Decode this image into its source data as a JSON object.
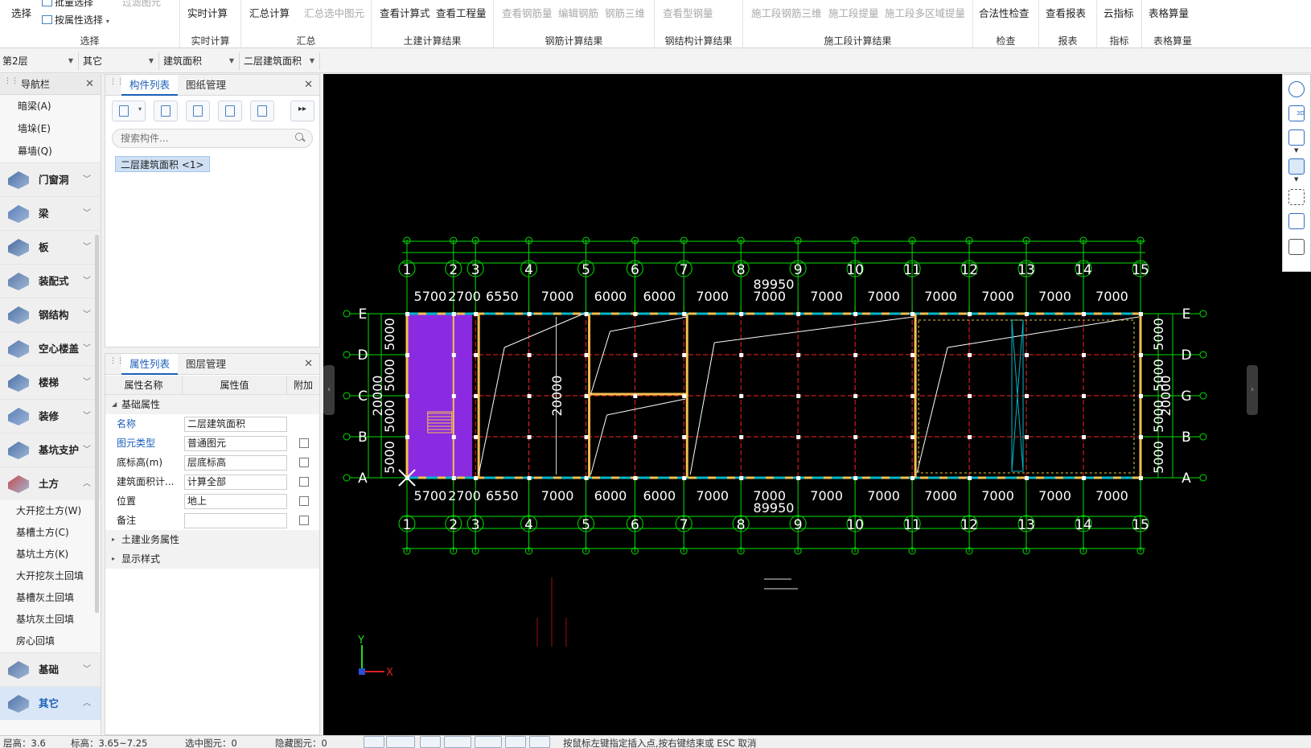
{
  "ribbon": {
    "select_group": {
      "select": "选择",
      "batch_select": "批量选择",
      "filter": "过滤图元",
      "by_attr": "按属性选择",
      "label": "选择"
    },
    "realtime_group": {
      "realtime": "实时计算",
      "label": "实时计算"
    },
    "summary_group": {
      "summary": "汇总计算",
      "summary_selected": "汇总选中图元",
      "label": "汇总"
    },
    "civil_group": {
      "formula": "查看计算式",
      "quantity": "查看工程量",
      "label": "土建计算结果"
    },
    "rebar_group": {
      "view_rebar": "查看钢筋量",
      "edit_rebar": "编辑钢筋",
      "rebar_3d": "钢筋三维",
      "label": "钢筋计算结果"
    },
    "steel_group": {
      "view_steel": "查看型钢量",
      "label": "钢结构计算结果"
    },
    "stage_group": {
      "stage_rebar_3d": "施工段钢筋三维",
      "stage_extract": "施工段提量",
      "stage_multi": "施工段多区域提量",
      "label": "施工段计算结果"
    },
    "check_group": {
      "legality": "合法性检查",
      "label": "检查"
    },
    "report_group": {
      "view_report": "查看报表",
      "label": "报表"
    },
    "index_group": {
      "cloud_index": "云指标",
      "label": "指标"
    },
    "table_group": {
      "table_calc": "表格算量",
      "label": "表格算量"
    }
  },
  "floorbar": {
    "floor": "第2层",
    "category": "其它",
    "type": "建筑面积",
    "component": "二层建筑面积"
  },
  "nav": {
    "title": "导航栏",
    "sub_top": [
      "暗梁(A)",
      "墙垛(E)",
      "幕墙(Q)"
    ],
    "categories": [
      "门窗洞",
      "梁",
      "板",
      "装配式",
      "钢结构",
      "空心楼盖",
      "楼梯",
      "装修",
      "基坑支护",
      "土方"
    ],
    "earth_items": [
      "大开挖土方(W)",
      "基槽土方(C)",
      "基坑土方(K)",
      "大开挖灰土回填",
      "基槽灰土回填",
      "基坑灰土回填",
      "房心回填"
    ],
    "bottom_categories": [
      "基础",
      "其它"
    ]
  },
  "comp_panel": {
    "tab_list": "构件列表",
    "tab_drawing": "图纸管理",
    "search_placeholder": "搜索构件...",
    "item": "二层建筑面积 <1>"
  },
  "prop_panel": {
    "tab_props": "属性列表",
    "tab_layers": "图层管理",
    "col_name": "属性名称",
    "col_value": "属性值",
    "col_extra": "附加",
    "group_basic": "基础属性",
    "rows": [
      {
        "name": "名称",
        "value": "二层建筑面积"
      },
      {
        "name": "图元类型",
        "value": "普通图元"
      },
      {
        "name": "底标高(m)",
        "value": "层底标高"
      },
      {
        "name": "建筑面积计...",
        "value": "计算全部"
      },
      {
        "name": "位置",
        "value": "地上"
      },
      {
        "name": "备注",
        "value": ""
      }
    ],
    "group_civil": "土建业务属性",
    "group_display": "显示样式"
  },
  "canvas": {
    "axis_numbers": [
      "1",
      "2",
      "3",
      "4",
      "5",
      "6",
      "7",
      "8",
      "9",
      "10",
      "11",
      "12",
      "13",
      "14",
      "15"
    ],
    "axis_letters_left": [
      "E",
      "D",
      "C",
      "B",
      "A"
    ],
    "axis_letters_right": [
      "E",
      "D",
      "G",
      "B",
      "A"
    ],
    "top_dims": [
      "5700",
      "2700",
      "6550",
      "7000",
      "6000",
      "6000",
      "7000",
      "7000",
      "7000",
      "7000",
      "7000",
      "7000",
      "7000",
      "7000"
    ],
    "bottom_dims": [
      "5700",
      "2700",
      "6550",
      "7000",
      "6000",
      "6000",
      "7000",
      "7000",
      "7000",
      "7000",
      "7000",
      "7000",
      "7000",
      "7000"
    ],
    "total_dim": "89950",
    "side_dims": [
      "5000",
      "5000",
      "5000",
      "5000"
    ],
    "side_total": "20000",
    "inner_dim": "20000",
    "axis_y": "Y",
    "axis_x": "X",
    "colors": {
      "grid": "#00e000",
      "axis": "#ff2020",
      "wall": "#f5c050",
      "area": "#8a2be2",
      "cyan": "#00b7c7"
    }
  },
  "statusbar": {
    "floor_height": "层高：3.6",
    "elevation": "标高：3.65~7.25",
    "selected": "选中图元：0",
    "hidden": "隐藏图元：0",
    "hint": "按鼠标左键指定插入点,按右键结束或 ESC 取消"
  }
}
